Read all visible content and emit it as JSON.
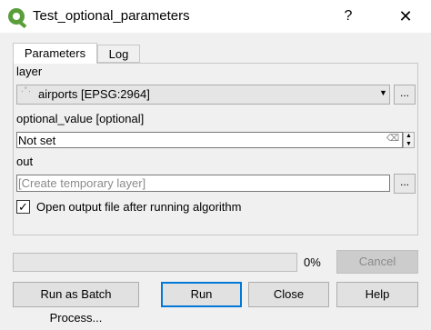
{
  "window": {
    "title": "Test_optional_parameters",
    "help_label": "?",
    "close_label": "✕"
  },
  "tabs": [
    {
      "label": "Parameters",
      "active": true
    },
    {
      "label": "Log",
      "active": false
    }
  ],
  "params": {
    "layer_label": "layer",
    "layer_value": "airports [EPSG:2964]",
    "layer_icon": "point-layer-icon",
    "optional_label": "optional_value [optional]",
    "optional_value": "Not set",
    "out_label": "out",
    "out_placeholder": "[Create temporary layer]",
    "browse_label": "...",
    "open_checkbox_label": "Open output file after running algorithm",
    "open_checked": true
  },
  "progress": {
    "value": 0,
    "text": "0%"
  },
  "buttons": {
    "cancel": "Cancel",
    "batch": "Run as Batch Process...",
    "run": "Run",
    "close": "Close",
    "help": "Help"
  },
  "colors": {
    "accent": "#0078d7",
    "progress": "#06b025",
    "logo": "#5a9e3a"
  }
}
